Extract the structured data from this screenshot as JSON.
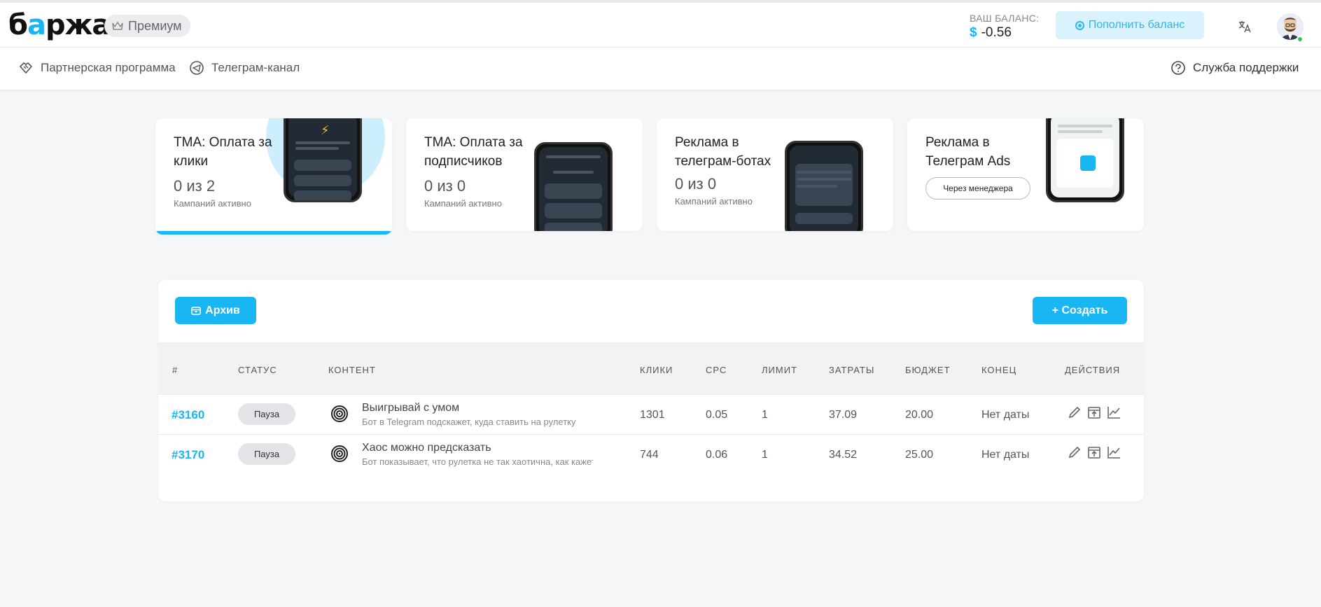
{
  "header": {
    "logo": {
      "part1": "б",
      "accent": "а",
      "part2": "ржа"
    },
    "premium_label": "Премиум",
    "balance_label": "ВАШ БАЛАНС:",
    "balance_currency": "$",
    "balance_value": "-0.56",
    "topup_label": "Пополнить баланс",
    "translate_icon": "translate-icon",
    "accent_color": "#19b6f4"
  },
  "subnav": {
    "partner_label": "Партнерская программа",
    "telegram_label": "Телеграм-канал",
    "support_label": "Служба поддержки"
  },
  "cards": [
    {
      "title": "TMA: Оплата за клики",
      "count": "0 из 2",
      "sub": "Кампаний активно",
      "active": true
    },
    {
      "title": "TMA: Оплата за подписчиков",
      "count": "0 из 0",
      "sub": "Кампаний активно",
      "active": false
    },
    {
      "title": "Реклама в телеграм-ботах",
      "count": "0 из 0",
      "sub": "Кампаний активно",
      "active": false
    },
    {
      "title": "Реклама в Телеграм Ads",
      "button": "Через менеджера",
      "active": false
    }
  ],
  "panel": {
    "archive_label": "Архив",
    "create_label": "+ Создать",
    "columns": [
      "#",
      "СТАТУС",
      "КОНТЕНТ",
      "КЛИКИ",
      "CPC",
      "ЛИМИТ",
      "ЗАТРАТЫ",
      "БЮДЖЕТ",
      "КОНЕЦ",
      "ДЕЙСТВИЯ"
    ],
    "rows": [
      {
        "id": "#3160",
        "status": "Пауза",
        "title": "Выигрывай с умом",
        "desc": "Бот в Telegram подскажет, куда ставить на рулетку",
        "clicks": "1301",
        "cpc": "0.05",
        "limit": "1",
        "spend": "37.09",
        "budget": "20.00",
        "end": "Нет даты"
      },
      {
        "id": "#3170",
        "status": "Пауза",
        "title": "Хаос можно предсказать",
        "desc": "Бот показывает, что рулетка не так хаотична, как кажется",
        "clicks": "744",
        "cpc": "0.06",
        "limit": "1",
        "spend": "34.52",
        "budget": "25.00",
        "end": "Нет даты"
      }
    ]
  }
}
